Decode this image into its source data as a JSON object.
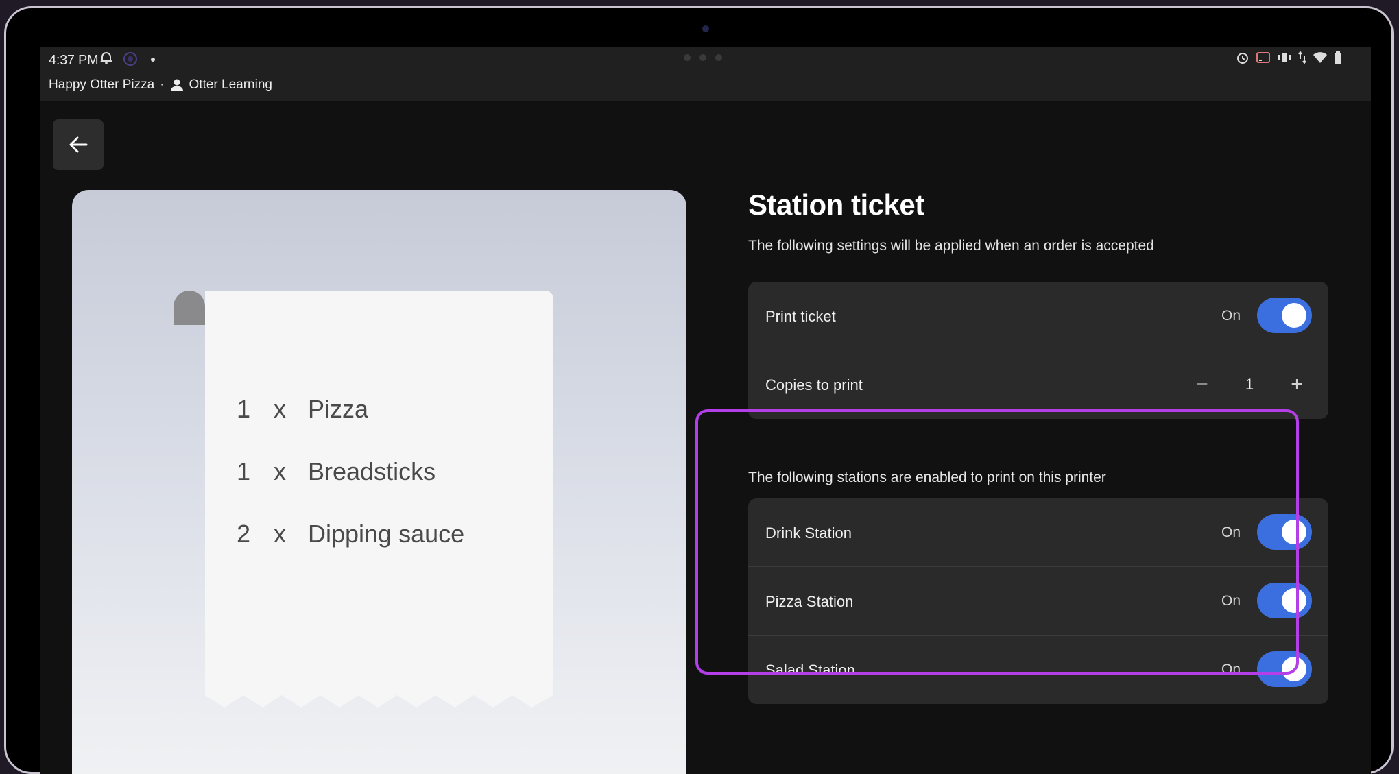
{
  "status_bar": {
    "time": "4:37 PM",
    "store": "Happy Otter Pizza",
    "separator": "·",
    "user": "Otter Learning"
  },
  "receipt": {
    "items": [
      {
        "qty": "1",
        "x": "x",
        "name": "Pizza"
      },
      {
        "qty": "1",
        "x": "x",
        "name": "Breadsticks"
      },
      {
        "qty": "2",
        "x": "x",
        "name": "Dipping sauce"
      }
    ]
  },
  "settings": {
    "title": "Station ticket",
    "subtitle": "The following settings will be applied when an order is accepted",
    "print_ticket": {
      "label": "Print ticket",
      "state": "On",
      "enabled": true
    },
    "copies": {
      "label": "Copies to print",
      "value": "1",
      "minus": "−",
      "plus": "+"
    }
  },
  "stations": {
    "label": "The following stations are enabled to print on this printer",
    "items": [
      {
        "label": "Drink Station",
        "state": "On",
        "enabled": true
      },
      {
        "label": "Pizza Station",
        "state": "On",
        "enabled": true
      },
      {
        "label": "Salad Station",
        "state": "On",
        "enabled": true
      }
    ]
  },
  "colors": {
    "toggle_on": "#3b6fe0",
    "highlight": "#b43ee8",
    "card_bg": "#2a2a2a"
  }
}
